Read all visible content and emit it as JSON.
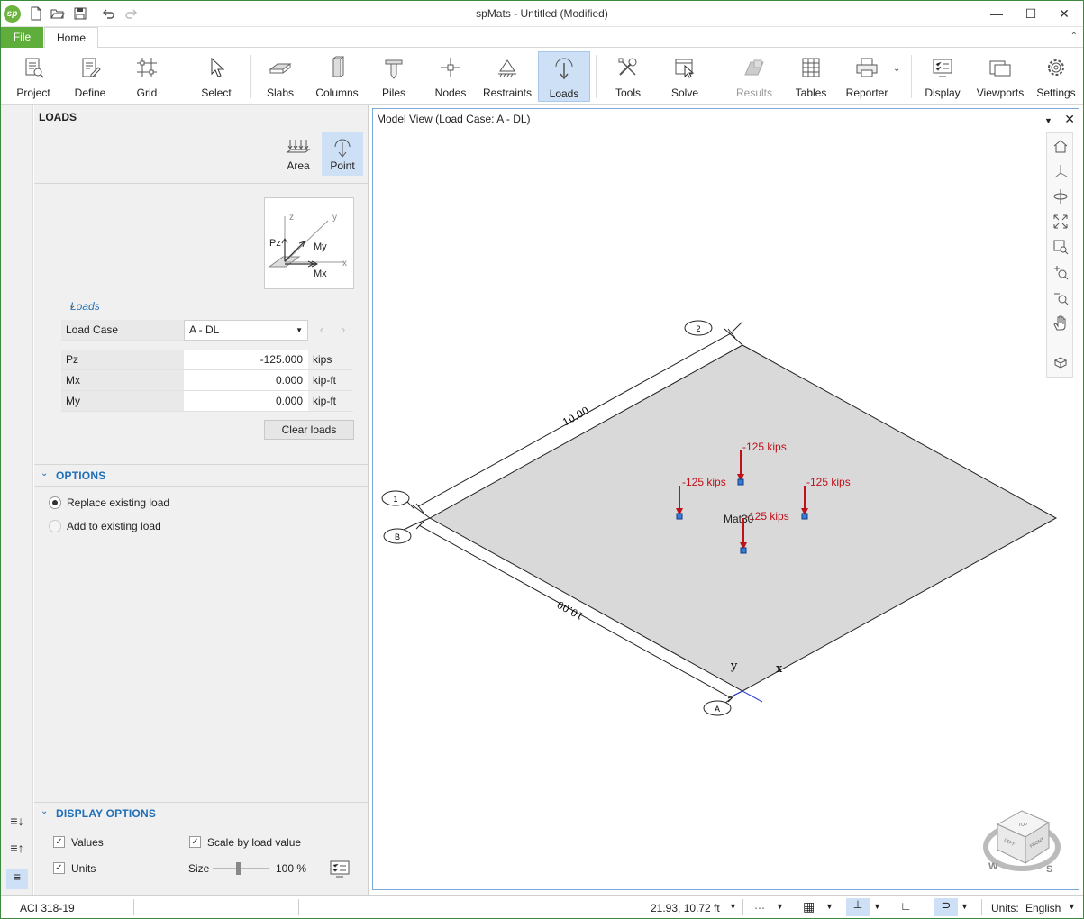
{
  "app": {
    "title": "spMats - Untitled (Modified)",
    "logo_text": "sp",
    "accent_color": "#5fae3c"
  },
  "tabs": {
    "file": "File",
    "home": "Home"
  },
  "ribbon": {
    "project": "Project",
    "define": "Define",
    "grid": "Grid",
    "select": "Select",
    "slabs": "Slabs",
    "columns": "Columns",
    "piles": "Piles",
    "nodes": "Nodes",
    "restraints": "Restraints",
    "loads": "Loads",
    "tools": "Tools",
    "solve": "Solve",
    "results": "Results",
    "tables": "Tables",
    "reporter": "Reporter",
    "display": "Display",
    "viewports": "Viewports",
    "settings": "Settings"
  },
  "panel": {
    "title": "LOADS",
    "area_btn": "Area",
    "point_btn": "Point",
    "diagram": {
      "z": "z",
      "y": "y",
      "x": "x",
      "pz": "Pz",
      "my": "My",
      "mx": "Mx"
    },
    "loads_section": "Loads",
    "load_case_label": "Load Case",
    "load_case_value": "A - DL",
    "rows": [
      {
        "label": "Pz",
        "value": "-125.000",
        "unit": "kips"
      },
      {
        "label": "Mx",
        "value": "0.000",
        "unit": "kip-ft"
      },
      {
        "label": "My",
        "value": "0.000",
        "unit": "kip-ft"
      }
    ],
    "clear_btn": "Clear loads",
    "options_header": "OPTIONS",
    "replace_label": "Replace existing load",
    "add_label": "Add to existing load",
    "display_header": "DISPLAY OPTIONS",
    "values_label": "Values",
    "units_label": "Units",
    "scale_label": "Scale by load value",
    "size_label": "Size",
    "size_value": "100 %",
    "size_fraction": 0.46
  },
  "view": {
    "title": "Model View (Load Case: A - DL)",
    "mat_label": "Mat30",
    "load_label": "-125 kips",
    "dim_top": "10.00",
    "dim_left": "10.00",
    "grid_bubbles": [
      "2",
      "1",
      "B",
      "A"
    ],
    "axis_x": "x",
    "axis_y": "y",
    "cube": {
      "top": "TOP",
      "front": "FRONT",
      "left": "LEFT",
      "w": "W",
      "s": "S"
    }
  },
  "status": {
    "code": "ACI 318-19",
    "coords": "21.93, 10.72 ft",
    "units_label": "Units:",
    "units_value": "English"
  }
}
